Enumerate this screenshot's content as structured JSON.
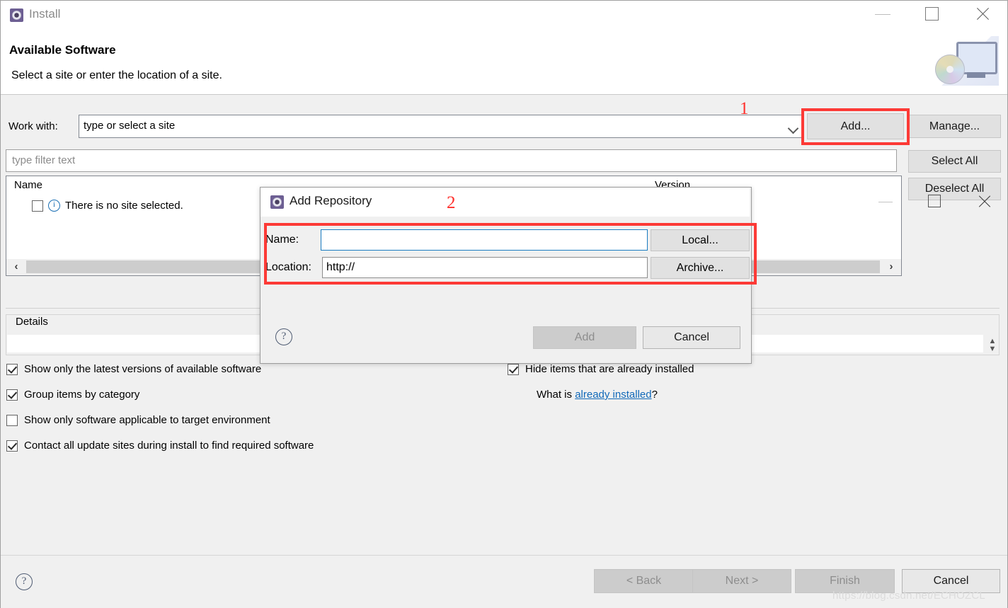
{
  "window": {
    "title": "Install",
    "controls": {
      "minimize": "minimize-icon",
      "maximize": "maximize-icon",
      "close": "close-icon"
    }
  },
  "header": {
    "heading": "Available Software",
    "subheading": "Select a site or enter the location of a site."
  },
  "work_with": {
    "label": "Work with:",
    "value": "type or select a site"
  },
  "filter": {
    "placeholder": "type filter text"
  },
  "buttons": {
    "add": "Add...",
    "manage": "Manage...",
    "select_all": "Select All",
    "deselect_all": "Deselect All"
  },
  "tree": {
    "columns": {
      "name": "Name",
      "version": "Version"
    },
    "rows": [
      {
        "checked": false,
        "icon": "info-icon",
        "label": "There is no site selected."
      }
    ]
  },
  "details": {
    "label": "Details",
    "value": ""
  },
  "options": {
    "left": [
      {
        "label": "Show only the latest versions of available software",
        "checked": true
      },
      {
        "label": "Group items by category",
        "checked": true
      },
      {
        "label": "Show only software applicable to target environment",
        "checked": false
      },
      {
        "label": "Contact all update sites during install to find required software",
        "checked": true
      }
    ],
    "right": [
      {
        "label": "Hide items that are already installed",
        "checked": true
      }
    ],
    "what_is_prefix": "What is ",
    "what_is_link": "already installed",
    "what_is_suffix": "?"
  },
  "footer": {
    "help": "?",
    "back": "< Back",
    "next": "Next >",
    "finish": "Finish",
    "cancel": "Cancel"
  },
  "watermark": "https://blog.csdn.net/ECHOZCL",
  "modal": {
    "title": "Add Repository",
    "name_label": "Name:",
    "name_value": "",
    "location_label": "Location:",
    "location_value": "http://",
    "local_button": "Local...",
    "archive_button": "Archive...",
    "help": "?",
    "add_button": "Add",
    "cancel_button": "Cancel"
  },
  "annotations": [
    {
      "number": "1",
      "target": "add-button"
    },
    {
      "number": "2",
      "target": "add-repository-dialog"
    }
  ],
  "colors": {
    "annotation_red": "#fc3a36",
    "link_blue": "#1169b9",
    "focus_blue": "#1a7cc1",
    "title_gray": "#8a8a8a"
  }
}
